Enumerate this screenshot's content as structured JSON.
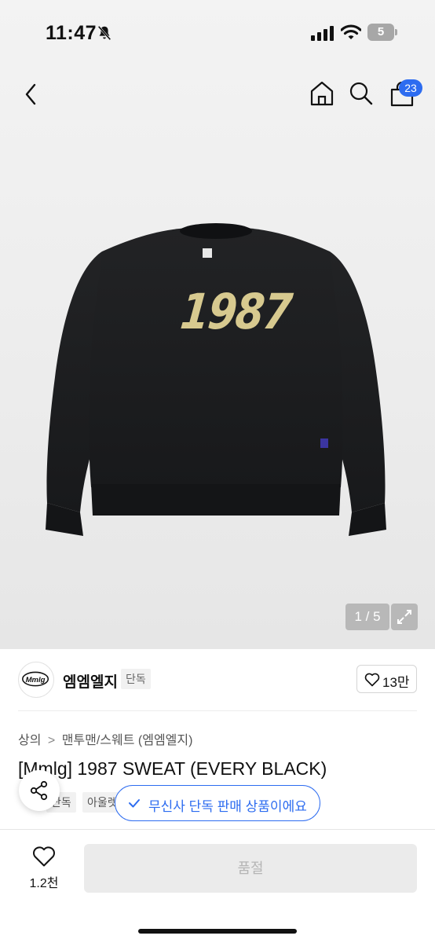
{
  "status_bar": {
    "time": "11:47",
    "battery": "5"
  },
  "header": {
    "cart_count": "23"
  },
  "gallery": {
    "counter": "1 / 5",
    "print_text": "1987"
  },
  "brand": {
    "logo_text": "Mmlg",
    "name": "엠엠엘지",
    "tag": "단독",
    "likes": "13만"
  },
  "breadcrumb": {
    "level1": "상의",
    "separator": ">",
    "level2": "맨투맨/스웨트 (엠엠엘지)"
  },
  "product": {
    "title": "[Mmlg] 1987 SWEAT (EVERY BLACK)",
    "tags": [
      "단독",
      "아울렛"
    ]
  },
  "exclusive_notice": "무신사 단독 판매 상품이에요",
  "bottom_bar": {
    "wish_count": "1.2천",
    "buy_label": "품절"
  },
  "colors": {
    "accent": "#2d6cf0",
    "sweater": "#1b1c1e",
    "print": "#d7c98f"
  }
}
